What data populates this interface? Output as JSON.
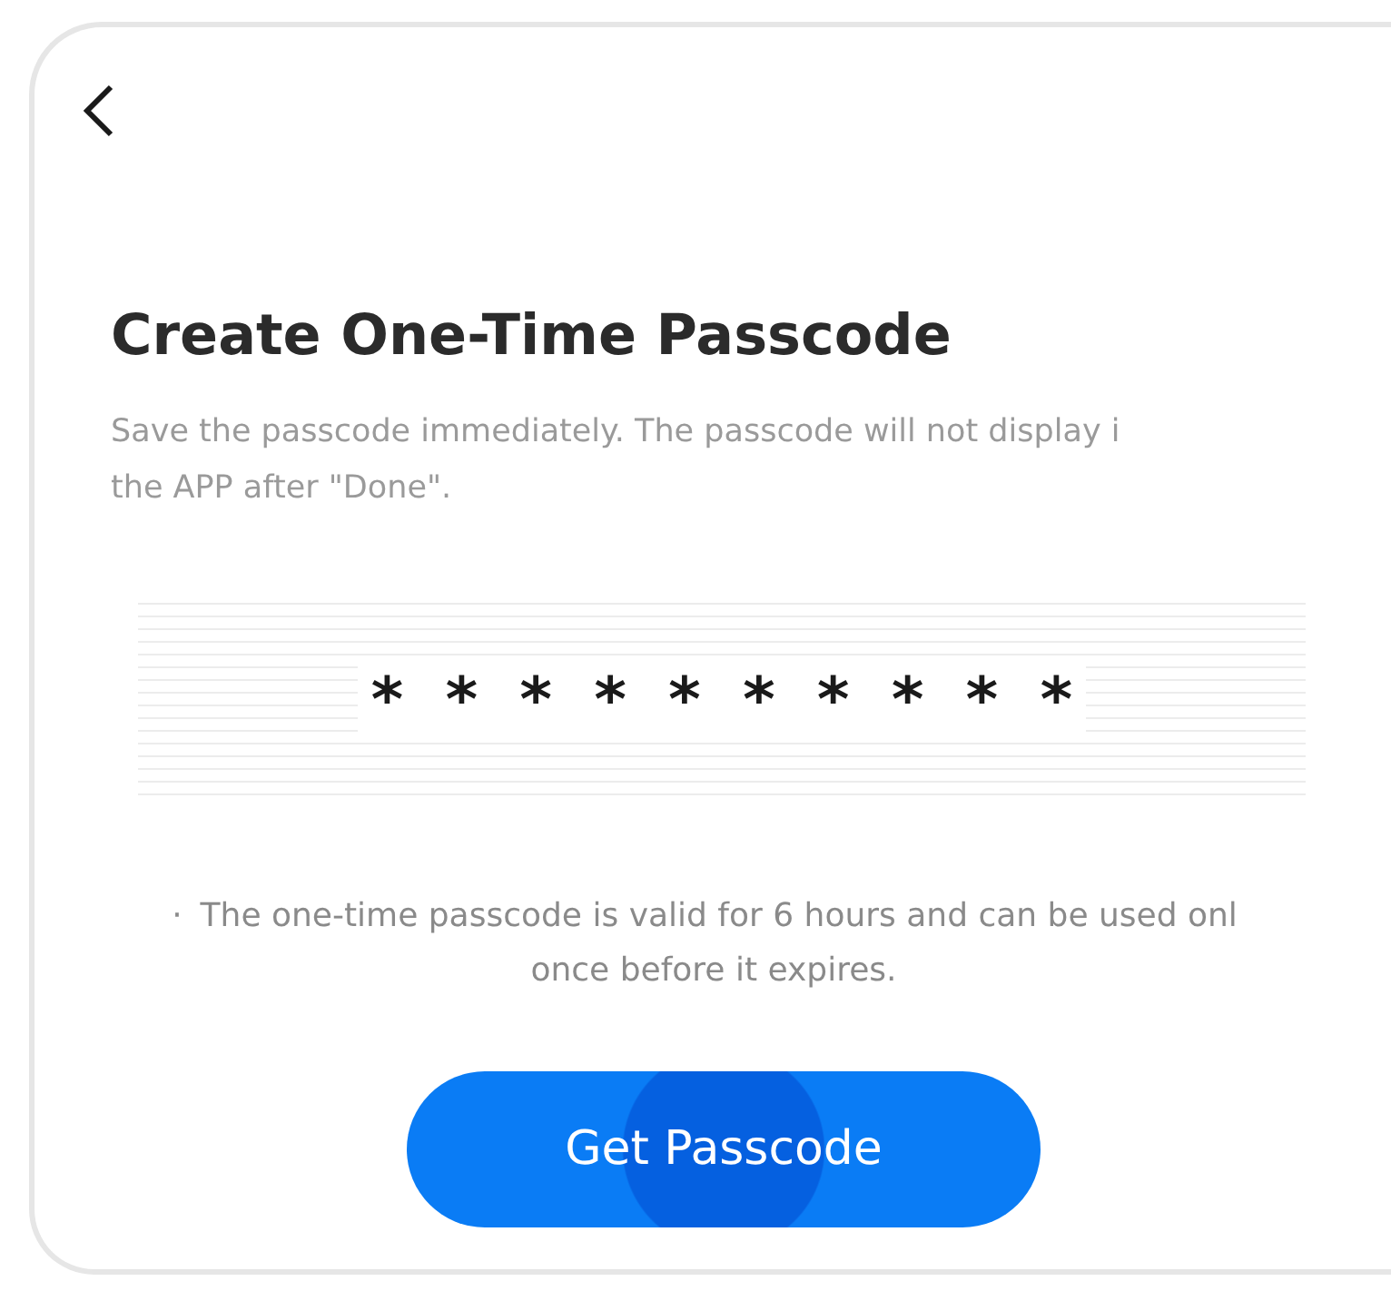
{
  "title": "Create One-Time Passcode",
  "subtitle_lines": [
    "Save the passcode immediately. The passcode will not display i",
    "the APP after \"Done\"."
  ],
  "passcode": "* * * * * * * * * *",
  "note_bullet": "·",
  "note_lines": [
    "The one-time passcode is valid for 6 hours and can be used onl",
    "once before it expires."
  ],
  "button": {
    "label": "Get Passcode",
    "pressed": true
  }
}
